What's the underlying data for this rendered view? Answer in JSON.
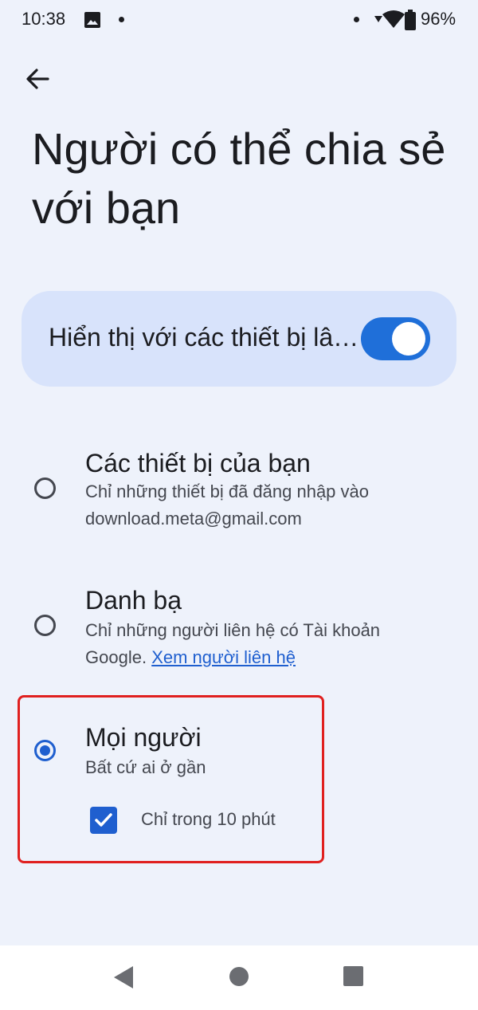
{
  "status_bar": {
    "time": "10:38",
    "battery_percent": "96%",
    "icons": [
      "image-icon",
      "dot-icon",
      "signal-icon",
      "wifi-icon",
      "battery-icon"
    ]
  },
  "header": {
    "back_icon": "arrow-back-icon",
    "title": "Người có thể chia sẻ với bạn"
  },
  "visibility": {
    "label": "Hiển thị với các thiết bị lân cận",
    "toggle_on": true,
    "accent_color": "#1f6fd9"
  },
  "options": [
    {
      "title": "Các thiết bị của bạn",
      "description": "Chỉ những thiết bị đã đăng nhập vào download.meta@gmail.com",
      "selected": false
    },
    {
      "title": "Danh bạ",
      "description": "Chỉ những người liên hệ có Tài khoản Google.",
      "link": "Xem người liên hệ",
      "selected": false
    },
    {
      "title": "Mọi người",
      "description": "Bất cứ ai ở gần",
      "selected": true,
      "checkbox_label": "Chỉ trong 10 phút",
      "checkbox_checked": true
    }
  ],
  "nav": {
    "icons": [
      "nav-back-icon",
      "nav-home-icon",
      "nav-recents-icon"
    ]
  },
  "colors": {
    "background": "#eef2fb",
    "card": "#d8e3fb",
    "selected": "#1f5fcf",
    "highlight_border": "#e0201f"
  }
}
